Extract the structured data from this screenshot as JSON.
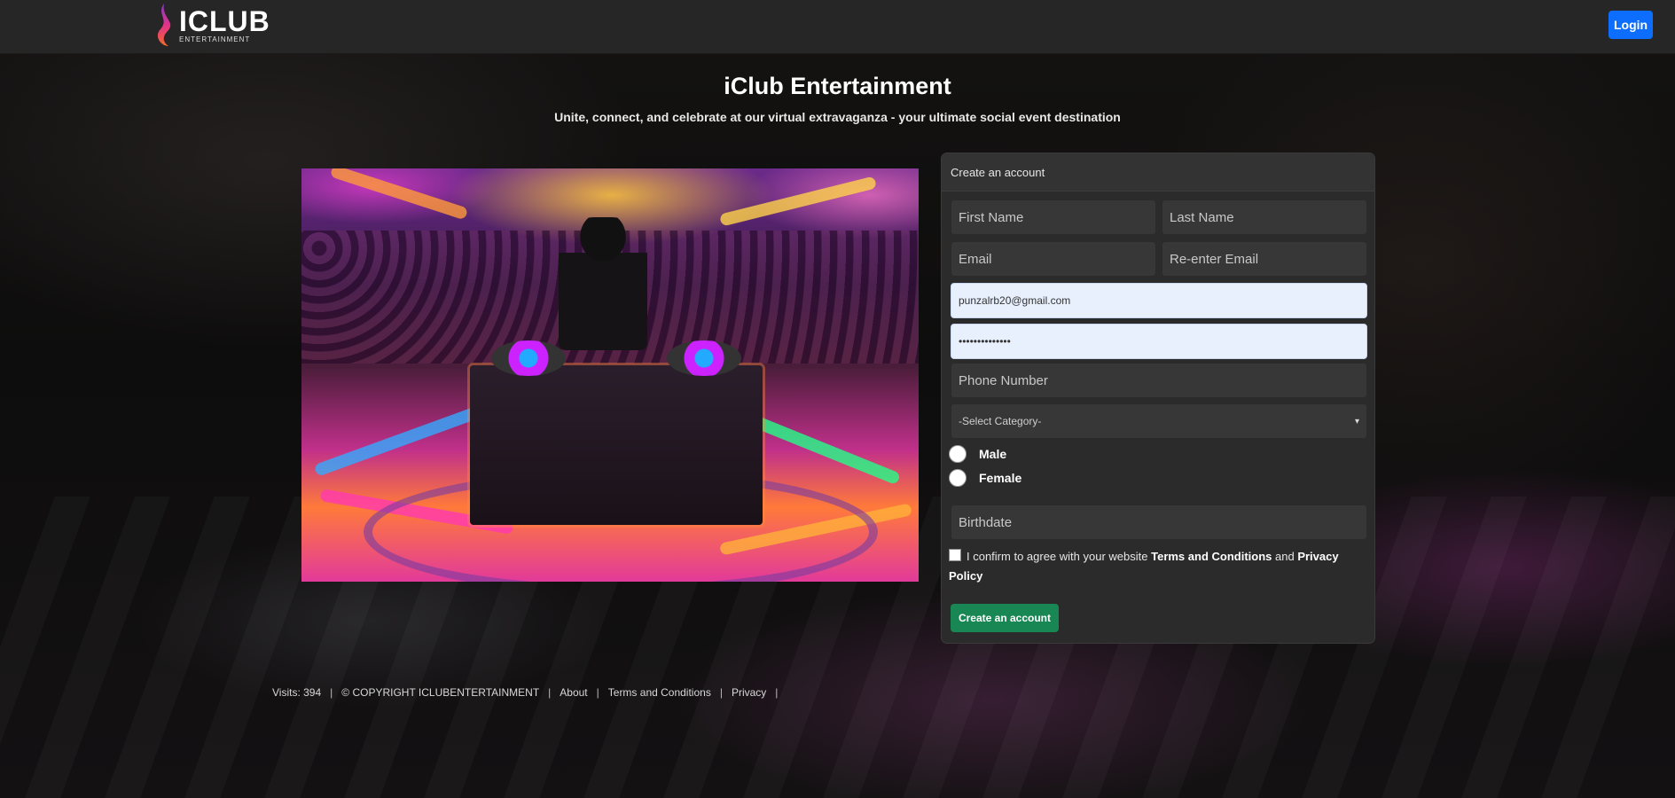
{
  "nav": {
    "logo_title": "ICLUB",
    "logo_sub": "ENTERTAINMENT",
    "login_label": "Login"
  },
  "hero": {
    "title": "iClub Entertainment",
    "subtitle": "Unite, connect, and celebrate at our virtual extravaganza - your ultimate social event destination"
  },
  "form": {
    "header": "Create an account",
    "first_name_placeholder": "First Name",
    "last_name_placeholder": "Last Name",
    "email_placeholder": "Email",
    "reenter_email_placeholder": "Re-enter Email",
    "filled_email_value": "punzalrb20@gmail.com",
    "password_value": "••••••••••••••",
    "phone_placeholder": "Phone Number",
    "category_selected": "-Select Category-",
    "gender_options": [
      "Male",
      "Female"
    ],
    "birthdate_placeholder": "Birthdate",
    "terms_prefix": "I confirm to agree with your website",
    "terms_link": "Terms and Conditions",
    "terms_and": "and",
    "privacy_link": "Privacy Policy",
    "create_label": "Create an account"
  },
  "footer": {
    "visits": "Visits: 394",
    "copyright": "© COPYRIGHT ICLUBENTERTAINMENT",
    "about": "About",
    "terms": "Terms and Conditions",
    "privacy": "Privacy"
  },
  "colors": {
    "navbar": "#262626",
    "login_button": "#0d6efd",
    "create_button": "#198754",
    "card": "#2b2b2b"
  }
}
